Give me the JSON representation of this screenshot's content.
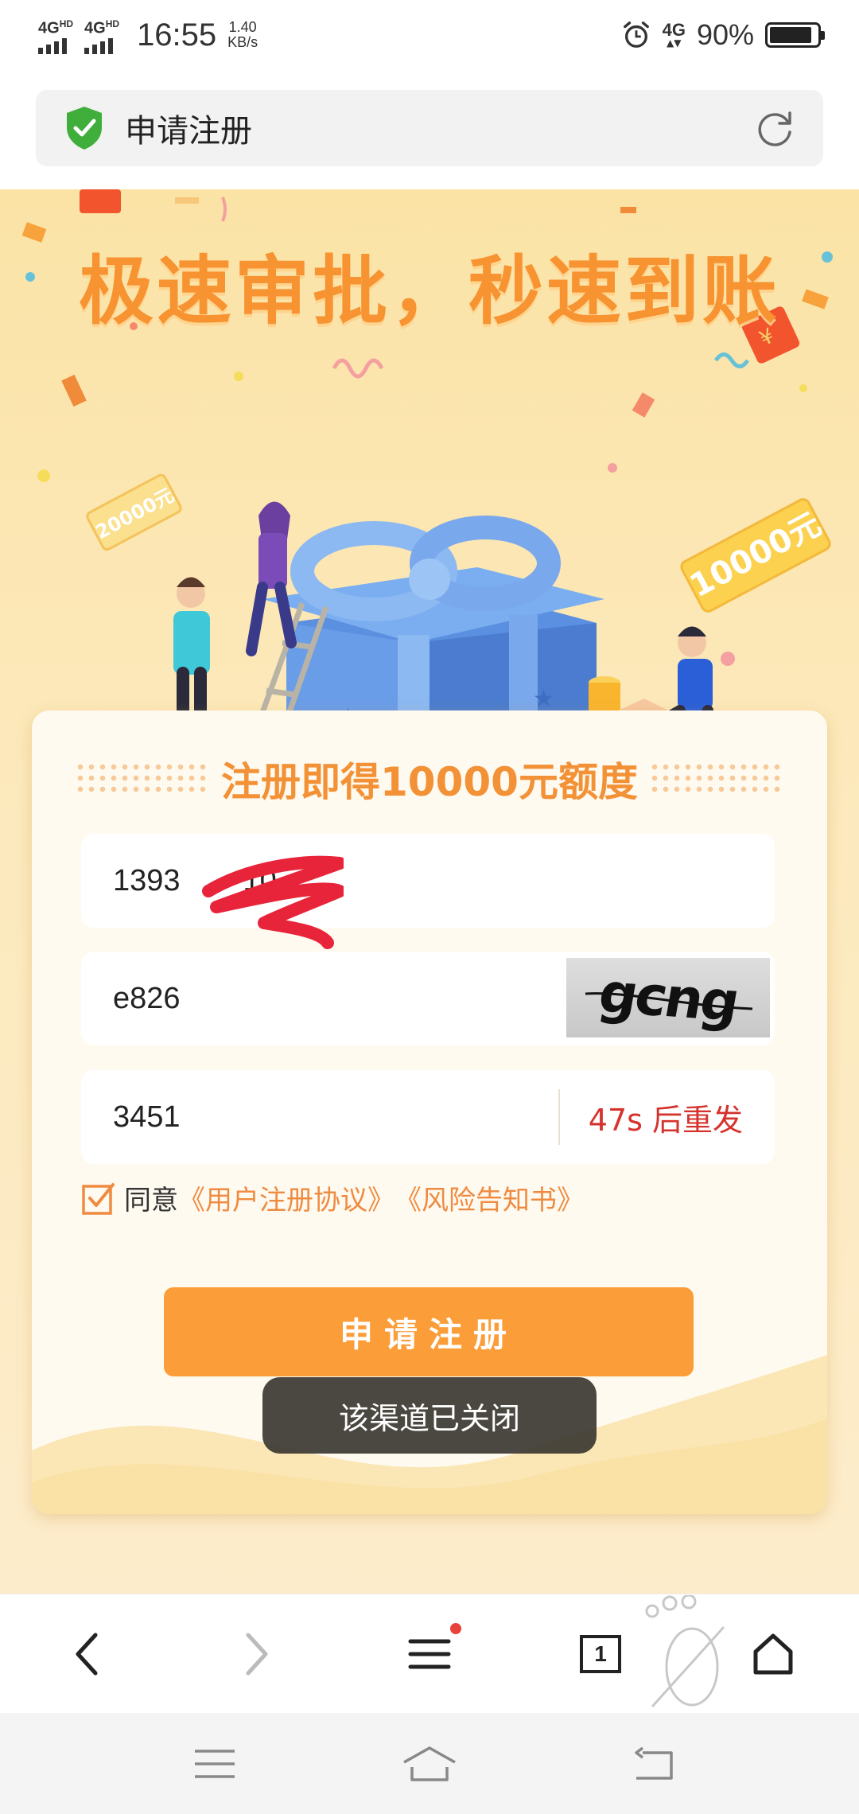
{
  "status_bar": {
    "network_1": "4G",
    "network_1_sup": "HD",
    "network_2": "4G",
    "network_2_sup": "HD",
    "time": "16:55",
    "net_speed_value": "1.40",
    "net_speed_unit": "KB/s",
    "network_3": "4G",
    "battery_percent": "90%",
    "battery_level": 0.9,
    "icons": [
      "signal-icon",
      "alarm-icon",
      "battery-icon"
    ]
  },
  "address_bar": {
    "title": "申请注册",
    "secure_icon": "shield-check-icon",
    "reload_icon": "reload-icon"
  },
  "page": {
    "headline": "极速审批，秒速到账",
    "banner_tag_left": "20000元",
    "banner_tag_right": "10000元",
    "promo": "注册即得10000元额度",
    "form": {
      "phone_value": "139311111810",
      "phone_visible": "1393",
      "phone_visible_end": "10",
      "captcha_value": "e826",
      "captcha_image_text": "gcng",
      "sms_code_value": "3451",
      "resend_label": "47s 后重发"
    },
    "agreement": {
      "checked": true,
      "prefix": "同意",
      "link_1": "《用户注册协议》",
      "link_2": "《风险告知书》"
    },
    "submit_label": "申请注册"
  },
  "toast": {
    "message": "该渠道已关闭"
  },
  "browser_toolbar": {
    "tab_count": "1",
    "items": [
      "back-icon",
      "forward-icon",
      "menu-icon",
      "tabs-icon",
      "home-icon"
    ]
  },
  "system_nav": {
    "items": [
      "recent-apps-icon",
      "home-icon",
      "back-icon"
    ]
  },
  "colors": {
    "accent_orange": "#fb9d38",
    "headline_orange": "#f79331",
    "resend_red": "#d6322c",
    "link_orange": "#ef8b41",
    "banner_bg": "#fbe3a6"
  }
}
